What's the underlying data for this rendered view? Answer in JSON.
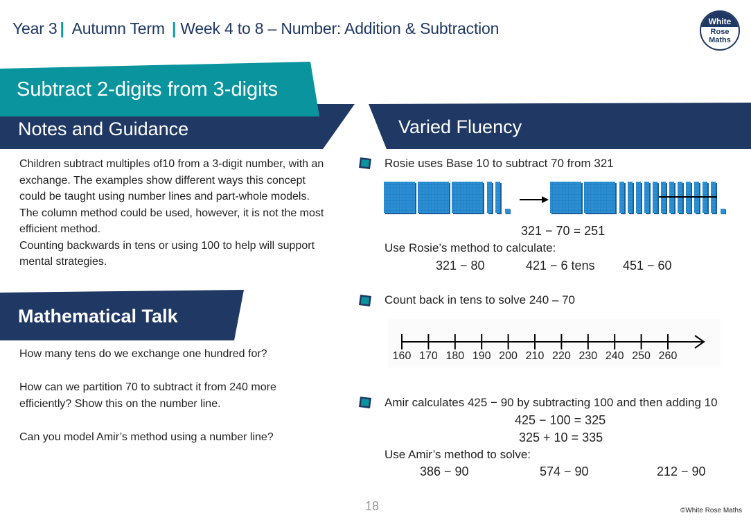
{
  "header": {
    "year": "Year 3",
    "term": "Autumn Term",
    "week": "Week 4 to 8 – Number: Addition & Subtraction",
    "separator": "|"
  },
  "logo": {
    "line1": "White",
    "line2": "Rose",
    "line3": "Maths"
  },
  "colors": {
    "navy": "#1f3864",
    "teal": "#0a949e"
  },
  "lesson_title": "Subtract 2-digits from 3-digits",
  "notes": {
    "title": "Notes and Guidance",
    "paragraphs": [
      "Children subtract multiples of10 from a 3-digit number, with an exchange. The examples show different ways this concept could be taught using number lines and part-whole models.",
      "The column method could be used, however, it is not the most efficient method.",
      "Counting backwards in tens or using 100 to help will support mental strategies."
    ]
  },
  "talk": {
    "title": "Mathematical Talk",
    "questions": [
      "How many tens do we exchange one hundred for?",
      "How can we partition 70 to subtract it from 240 more efficiently? Show this on the number line.",
      "Can you model Amir’s method using a number line?"
    ]
  },
  "fluency": {
    "title": "Varied Fluency",
    "q1": {
      "prompt": "Rosie uses Base 10 to subtract 70 from 321",
      "before": {
        "hundreds": 3,
        "tens": 2,
        "ones": 1
      },
      "after": {
        "hundreds": 2,
        "tens": 12,
        "ones": 1,
        "crossed_tens": 7
      },
      "equation": "321 − 70 = 251",
      "instruction": "Use Rosie’s method to calculate:",
      "problems": [
        "321 − 80",
        "421 − 6 tens",
        "451 − 60"
      ]
    },
    "q2": {
      "prompt": "Count back in tens to solve 240 – 70",
      "number_line": [
        160,
        170,
        180,
        190,
        200,
        210,
        220,
        230,
        240,
        250,
        260
      ]
    },
    "q3": {
      "prompt": "Amir calculates 425 − 90 by subtracting 100 and then adding 10",
      "steps": [
        "425 − 100 = 325",
        "325 + 10 = 335"
      ],
      "instruction": "Use Amir’s method to solve:",
      "problems": [
        "386 − 90",
        "574 − 90",
        "212 − 90"
      ]
    }
  },
  "footer": {
    "page_number": "18",
    "copyright": "©White Rose Maths"
  }
}
